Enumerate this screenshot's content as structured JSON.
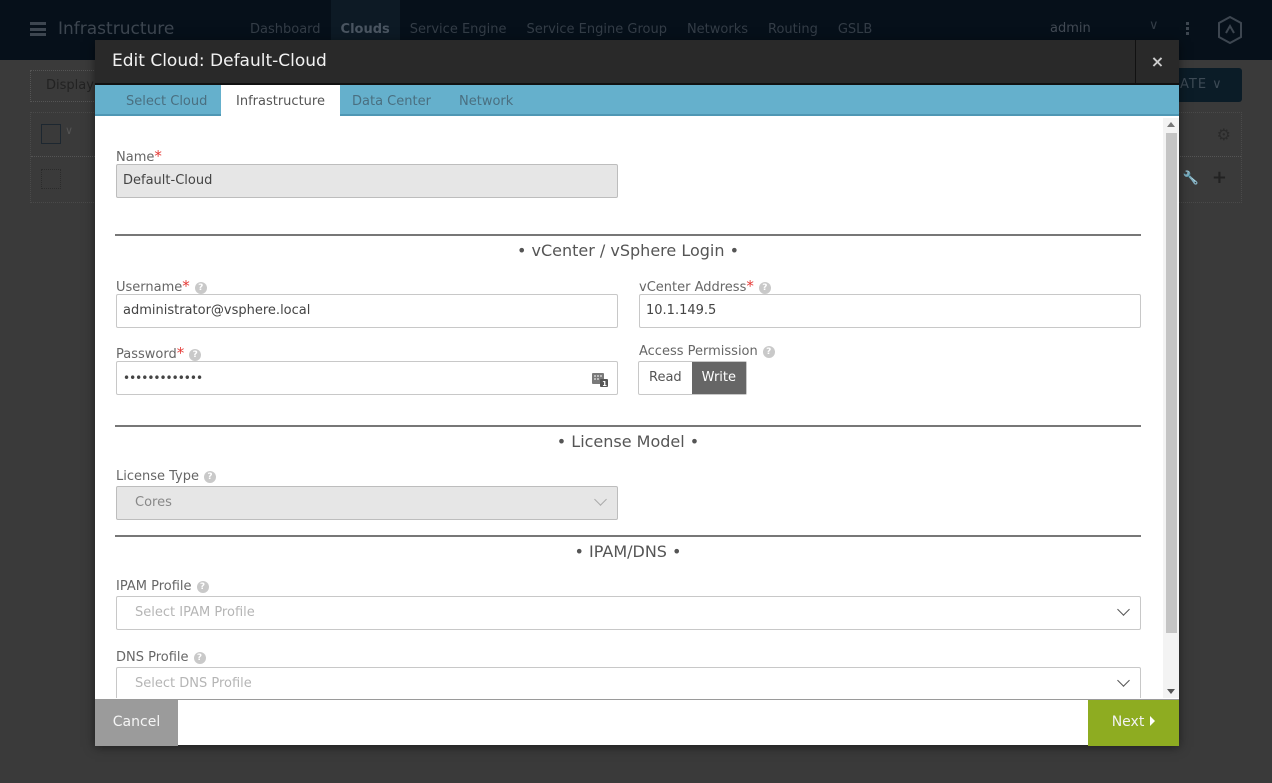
{
  "topnav": {
    "app_title": "Infrastructure",
    "items": [
      {
        "label": "Dashboard",
        "active": false
      },
      {
        "label": "Clouds",
        "active": true
      },
      {
        "label": "Service Engine",
        "active": false
      },
      {
        "label": "Service Engine Group",
        "active": false
      },
      {
        "label": "Networks",
        "active": false
      },
      {
        "label": "Routing",
        "active": false
      },
      {
        "label": "GSLB",
        "active": false
      }
    ],
    "user": "admin"
  },
  "background": {
    "toolbar_text": "Displayi",
    "create_button": "ATE"
  },
  "modal": {
    "title": "Edit Cloud: Default-Cloud",
    "close_icon": "×",
    "tabs": [
      {
        "label": "Select Cloud",
        "active": false
      },
      {
        "label": "Infrastructure",
        "active": true
      },
      {
        "label": "Data Center",
        "active": false
      },
      {
        "label": "Network",
        "active": false
      }
    ],
    "form": {
      "name": {
        "label": "Name",
        "required": "*",
        "value": "Default-Cloud"
      },
      "vcenter_section": "• vCenter / vSphere Login •",
      "username": {
        "label": "Username",
        "required": "*",
        "value": "administrator@vsphere.local"
      },
      "vcenter_address": {
        "label": "vCenter Address",
        "required": "*",
        "value": "10.1.149.5"
      },
      "password": {
        "label": "Password",
        "required": "*",
        "value": "•••••••••••••"
      },
      "access_permission": {
        "label": "Access Permission",
        "options": [
          "Read",
          "Write"
        ],
        "selected": "Write"
      },
      "license_section": "• License Model •",
      "license_type": {
        "label": "License Type",
        "value": "Cores"
      },
      "ipam_section": "• IPAM/DNS •",
      "ipam_profile": {
        "label": "IPAM Profile",
        "placeholder": "Select IPAM Profile"
      },
      "dns_profile": {
        "label": "DNS Profile",
        "placeholder": "Select DNS Profile"
      }
    },
    "help_icon": "?",
    "footer": {
      "cancel_label": "Cancel",
      "next_label": "Next"
    }
  },
  "colors": {
    "tab_bar": "#65b0cc",
    "next_button": "#8eac21",
    "cancel_button": "#9b9b9b",
    "required": "#e53935"
  }
}
